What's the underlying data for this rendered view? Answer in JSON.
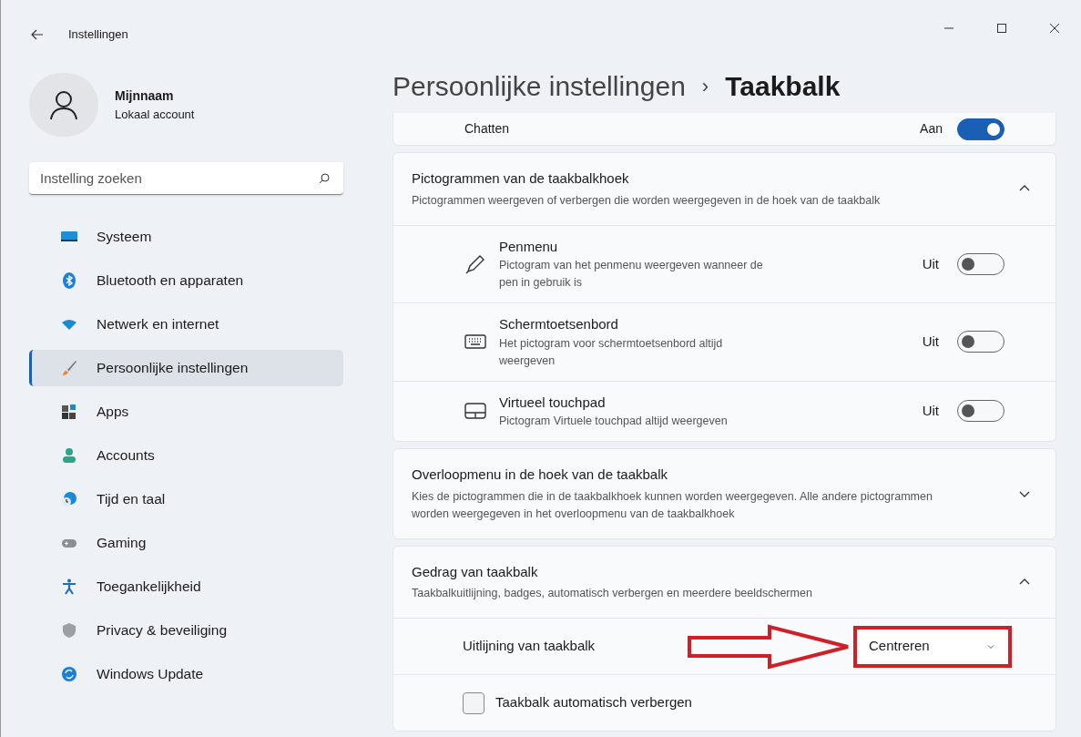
{
  "window": {
    "title": "Instellingen"
  },
  "profile": {
    "name": "Mijnnaam",
    "account": "Lokaal account"
  },
  "search": {
    "placeholder": "Instelling zoeken"
  },
  "sidebar": {
    "items": [
      {
        "label": "Systeem",
        "selected": false
      },
      {
        "label": "Bluetooth en apparaten",
        "selected": false
      },
      {
        "label": "Netwerk en internet",
        "selected": false
      },
      {
        "label": "Persoonlijke instellingen",
        "selected": true
      },
      {
        "label": "Apps",
        "selected": false
      },
      {
        "label": "Accounts",
        "selected": false
      },
      {
        "label": "Tijd en taal",
        "selected": false
      },
      {
        "label": "Gaming",
        "selected": false
      },
      {
        "label": "Toegankelijkheid",
        "selected": false
      },
      {
        "label": "Privacy & beveiliging",
        "selected": false
      },
      {
        "label": "Windows Update",
        "selected": false
      }
    ]
  },
  "breadcrumb": {
    "parent": "Persoonlijke instellingen",
    "separator": "›",
    "current": "Taakbalk"
  },
  "chat_row": {
    "label": "Chatten",
    "state_label": "Aan",
    "on": true
  },
  "sections": [
    {
      "title": "Pictogrammen van de taakbalkhoek",
      "description": "Pictogrammen weergeven of verbergen die worden weergegeven in de hoek van de taakbalk",
      "expanded": true,
      "rows": [
        {
          "kind": "toggle",
          "label": "Penmenu",
          "description": "Pictogram van het penmenu weergeven wanneer de pen in gebruik is",
          "state_label": "Uit",
          "on": false
        },
        {
          "kind": "toggle",
          "label": "Schermtoetsenbord",
          "description": "Het pictogram voor schermtoetsenbord altijd weergeven",
          "state_label": "Uit",
          "on": false
        },
        {
          "kind": "toggle",
          "label": "Virtueel touchpad",
          "description": "Pictogram Virtuele touchpad altijd weergeven",
          "state_label": "Uit",
          "on": false
        }
      ]
    },
    {
      "title": "Overloopmenu in de hoek van de taakbalk",
      "description": "Kies de pictogrammen die in de taakbalkhoek kunnen worden weergegeven. Alle andere pictogrammen worden weergegeven in het overloopmenu van de taakbalkhoek",
      "expanded": false
    },
    {
      "title": "Gedrag van taakbalk",
      "description": "Taakbalkuitlijning, badges, automatisch verbergen en meerdere beeldschermen",
      "expanded": true,
      "rows": [
        {
          "kind": "dropdown",
          "label": "Uitlijning van taakbalk",
          "value": "Centreren",
          "highlighted": true
        },
        {
          "kind": "checkbox",
          "label": "Taakbalk automatisch verbergen",
          "checked": false
        }
      ]
    }
  ]
}
